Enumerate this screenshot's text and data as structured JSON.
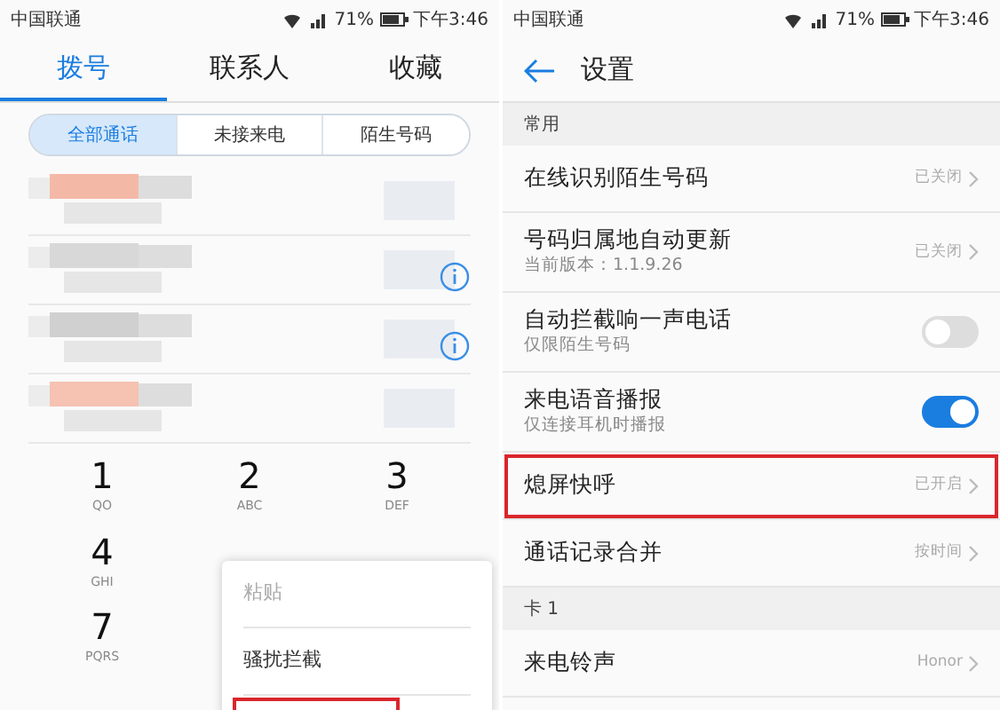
{
  "left_screen": {
    "status_bar": {
      "carrier": "中国联通",
      "battery": "71%",
      "time": "下午3:46"
    },
    "tabs": [
      {
        "label": "拨号",
        "selected": true
      },
      {
        "label": "联系人",
        "selected": false
      },
      {
        "label": "收藏",
        "selected": false
      }
    ],
    "filters": [
      {
        "label": "全部通话",
        "selected": true
      },
      {
        "label": "未接来电",
        "selected": false
      },
      {
        "label": "陌生号码",
        "selected": false
      }
    ],
    "call_rows": [
      {
        "info_button": false
      },
      {
        "info_button": true
      },
      {
        "info_button": true
      },
      {
        "info_button": false
      }
    ],
    "keypad": [
      {
        "digit": "1",
        "letters": "QO"
      },
      {
        "digit": "2",
        "letters": "ABC"
      },
      {
        "digit": "3",
        "letters": "DEF"
      },
      {
        "digit": "4",
        "letters": "GHI"
      },
      {
        "digit": "7",
        "letters": "PQRS"
      }
    ],
    "menu": {
      "items": [
        {
          "label": "粘贴",
          "disabled": true
        },
        {
          "label": "骚扰拦截",
          "disabled": false
        }
      ]
    }
  },
  "right_screen": {
    "status_bar": {
      "carrier": "中国联通",
      "battery": "71%",
      "time": "下午3:46"
    },
    "title": "设置",
    "sections": [
      {
        "header": "常用",
        "rows": [
          {
            "kind": "link",
            "title": "在线识别陌生号码",
            "value": "已关闭",
            "highlighted": false
          },
          {
            "kind": "link",
            "title": "号码归属地自动更新",
            "subtitle": "当前版本：1.1.9.26",
            "value": "已关闭",
            "highlighted": false
          },
          {
            "kind": "switch",
            "title": "自动拦截响一声电话",
            "subtitle": "仅限陌生号码",
            "on": false,
            "highlighted": false
          },
          {
            "kind": "switch",
            "title": "来电语音播报",
            "subtitle": "仅连接耳机时播报",
            "on": true,
            "highlighted": false
          },
          {
            "kind": "link",
            "title": "熄屏快呼",
            "value": "已开启",
            "highlighted": true
          },
          {
            "kind": "link",
            "title": "通话记录合并",
            "value": "按时间",
            "highlighted": false
          }
        ]
      },
      {
        "header": "卡 1",
        "rows": [
          {
            "kind": "link",
            "title": "来电铃声",
            "value": "Honor",
            "highlighted": false
          }
        ]
      }
    ]
  }
}
